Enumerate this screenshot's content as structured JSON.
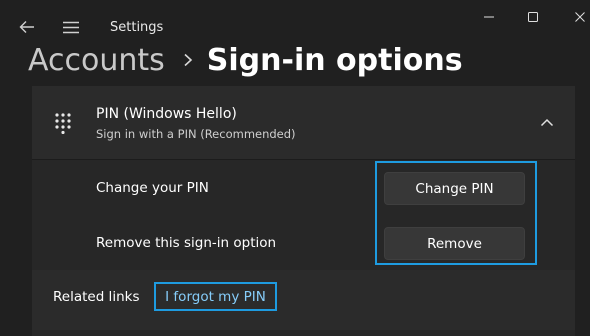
{
  "window": {
    "title": "Settings"
  },
  "breadcrumb": {
    "parent": "Accounts",
    "current": "Sign-in options"
  },
  "pin_card": {
    "title": "PIN (Windows Hello)",
    "subtitle": "Sign in with a PIN (Recommended)",
    "rows": [
      {
        "label": "Change your PIN",
        "button": "Change PIN"
      },
      {
        "label": "Remove this sign-in option",
        "button": "Remove"
      }
    ]
  },
  "related": {
    "label": "Related links",
    "link": "I forgot my PIN"
  },
  "colors": {
    "background": "#202020",
    "card": "#272727",
    "highlight": "#1e9be0",
    "link": "#86cdfa"
  },
  "icons": [
    "back-arrow-icon",
    "hamburger-menu-icon",
    "minimize-icon",
    "maximize-icon",
    "close-icon",
    "keypad-icon",
    "chevron-right-icon",
    "chevron-up-icon"
  ]
}
